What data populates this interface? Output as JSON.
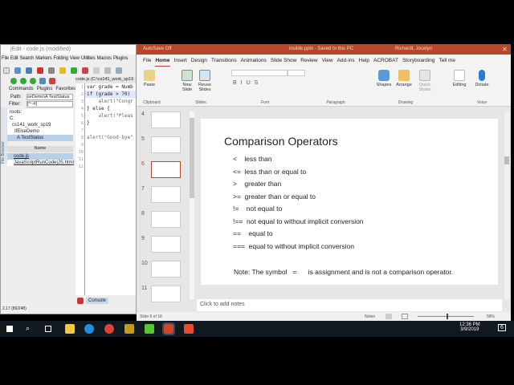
{
  "jedit": {
    "title": "jEdit - code.js (modified)",
    "menu": [
      "File",
      "Edit",
      "Search",
      "Markers",
      "Folding",
      "View",
      "Utilities",
      "Macros",
      "Plugins"
    ],
    "tabs": [
      "Commands",
      "Plugins",
      "Favorites"
    ],
    "path_label": "Path:",
    "path_value": "seDemo\\A TestStatus",
    "filter_label": "Filter:",
    "filter_value": "[^~#]",
    "tree": [
      "roots:",
      "C:",
      "cs141_work_sp19",
      "IfElseDemo",
      "A TestStatus"
    ],
    "files_header": "Name",
    "files": [
      "code.js",
      "JavaScriptRunCode|JS.html"
    ],
    "side_tab": "File Browser",
    "code_tab": "code.js (C:\\cs141_work_sp19",
    "code_lines": [
      "var grade = Numb",
      "if (grade > 70)",
      "    alert(\"Congr",
      "} else {",
      "    alert(\"Pleas",
      "}",
      "",
      "alert(\"Good-bye\"",
      "",
      "",
      "",
      ""
    ],
    "console_label": "Console",
    "status": "2,17 (86/248)"
  },
  "ppt": {
    "autosave": "AutoSave  Off",
    "title": "inslide.pptx - Saved to this PC",
    "user": "Richardt, Jocelyn",
    "tabs": [
      "File",
      "Home",
      "Insert",
      "Design",
      "Transitions",
      "Animations",
      "Slide Show",
      "Review",
      "View",
      "Add-ins",
      "Help",
      "ACROBAT",
      "Storyboarding",
      "Tell me"
    ],
    "ribbon": {
      "paste": "Paste",
      "new_slide": "New Slide",
      "reuse": "Reuse Slides",
      "shapes": "Shapes",
      "arrange": "Arrange",
      "quick_styles": "Quick Styles",
      "editing": "Editing",
      "dictate": "Dictate",
      "groups": [
        "Clipboard",
        "Slides",
        "Font",
        "Paragraph",
        "Drawing",
        "Voice"
      ]
    },
    "thumb_numbers": [
      "4",
      "5",
      "6",
      "7",
      "8",
      "9",
      "10",
      "11"
    ],
    "selected_thumb": "6",
    "slide": {
      "title": "Comparison Operators",
      "items": [
        "<    less than",
        "<=  less than or equal to",
        ">    greater than",
        ">=  greater than or equal to",
        "!=    not equal to",
        "!==  not equal to without implicit conversion",
        "==    equal to",
        "===  equal to without implicit conversion"
      ],
      "note": "Note: The symbol   =      is assignment and is not a comparison operator."
    },
    "notes_placeholder": "Click to add notes",
    "status": {
      "slide": "Slide 6 of 18",
      "notes": "Notes",
      "zoom": "58%"
    }
  },
  "taskbar": {
    "time": "12:36 PM",
    "date": "3/9/2019",
    "notif": "6"
  }
}
